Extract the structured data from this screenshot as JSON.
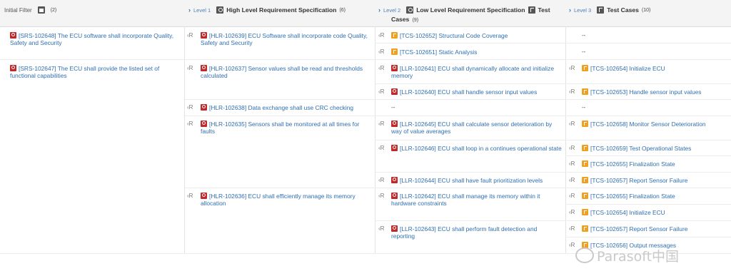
{
  "header": {
    "initial_filter": {
      "label": "Initial Filter",
      "count": "(2)"
    },
    "col1": {
      "level": "Level 1",
      "title": "High Level Requirement Specification",
      "count": "(6)"
    },
    "col2": {
      "level": "Level 2",
      "title": "Low Level Requirement Specification",
      "title2": "Test",
      "title3": "Cases",
      "count": "(9)"
    },
    "col3": {
      "level": "Level 3",
      "title": "Test Cases",
      "count": "(10)"
    }
  },
  "cr_label": "‹R",
  "dash": "--",
  "srs": [
    {
      "text": "[SRS-102648] The ECU software shall incorporate Quality, Safety and Security"
    },
    {
      "text": "[SRS-102647] The ECU shall provide the listed set of functional capabilities"
    }
  ],
  "hlr": [
    {
      "text": "[HLR-102639] ECU Software shall incorporate code Quality, Safety and Security"
    },
    {
      "text": "[HLR-102637] Sensor values shall be read and thresholds calculated"
    },
    {
      "text": "[HLR-102638] Data exchange shall use CRC checking"
    },
    {
      "text": "[HLR-102635] Sensors shall be monitored at all times for faults"
    },
    {
      "text": "[HLR-102636] ECU shall efficiently manage its memory allocation"
    }
  ],
  "l2": [
    {
      "kind": "tcs",
      "text": "[TCS-102652] Structural Code Coverage"
    },
    {
      "kind": "tcs",
      "text": "[TCS-102651] Static Analysis"
    },
    {
      "kind": "req",
      "text": "[LLR-102641] ECU shall dynamically allocate and initialize memory"
    },
    {
      "kind": "req",
      "text": "[LLR-102640] ECU shall handle sensor input values"
    },
    {
      "kind": "req",
      "text": "[LLR-102645] ECU shall calculate sensor deterioration by way of value averages"
    },
    {
      "kind": "req",
      "text": "[LLR-102646] ECU shall loop in a continues operational state"
    },
    {
      "kind": "req",
      "text": "[LLR-102644] ECU shall have fault prioritization levels"
    },
    {
      "kind": "req",
      "text": "[LLR-102642] ECU shall manage its memory within it hardware constraints"
    },
    {
      "kind": "req",
      "text": "[LLR-102643] ECU shall perform fault detection and reporting"
    }
  ],
  "l3": [
    {
      "text": "[TCS-102654] Initialize ECU"
    },
    {
      "text": "[TCS-102653] Handle sensor input values"
    },
    {
      "text": "[TCS-102658] Monitor Sensor Deterioration"
    },
    {
      "text": "[TCS-102659] Test Operational States"
    },
    {
      "text": "[TCS-102655] Finalization State"
    },
    {
      "text": "[TCS-102657] Report Sensor Failure"
    },
    {
      "text": "[TCS-102655] Finalization State"
    },
    {
      "text": "[TCS-102654] Initialize ECU"
    },
    {
      "text": "[TCS-102657] Report Sensor Failure"
    },
    {
      "text": "[TCS-102656] Output messages"
    }
  ],
  "watermark": "Parasoft中国",
  "colors": {
    "link": "#2f6fb2",
    "req_icon": "#c0282a",
    "tcs_icon": "#f0a020"
  }
}
